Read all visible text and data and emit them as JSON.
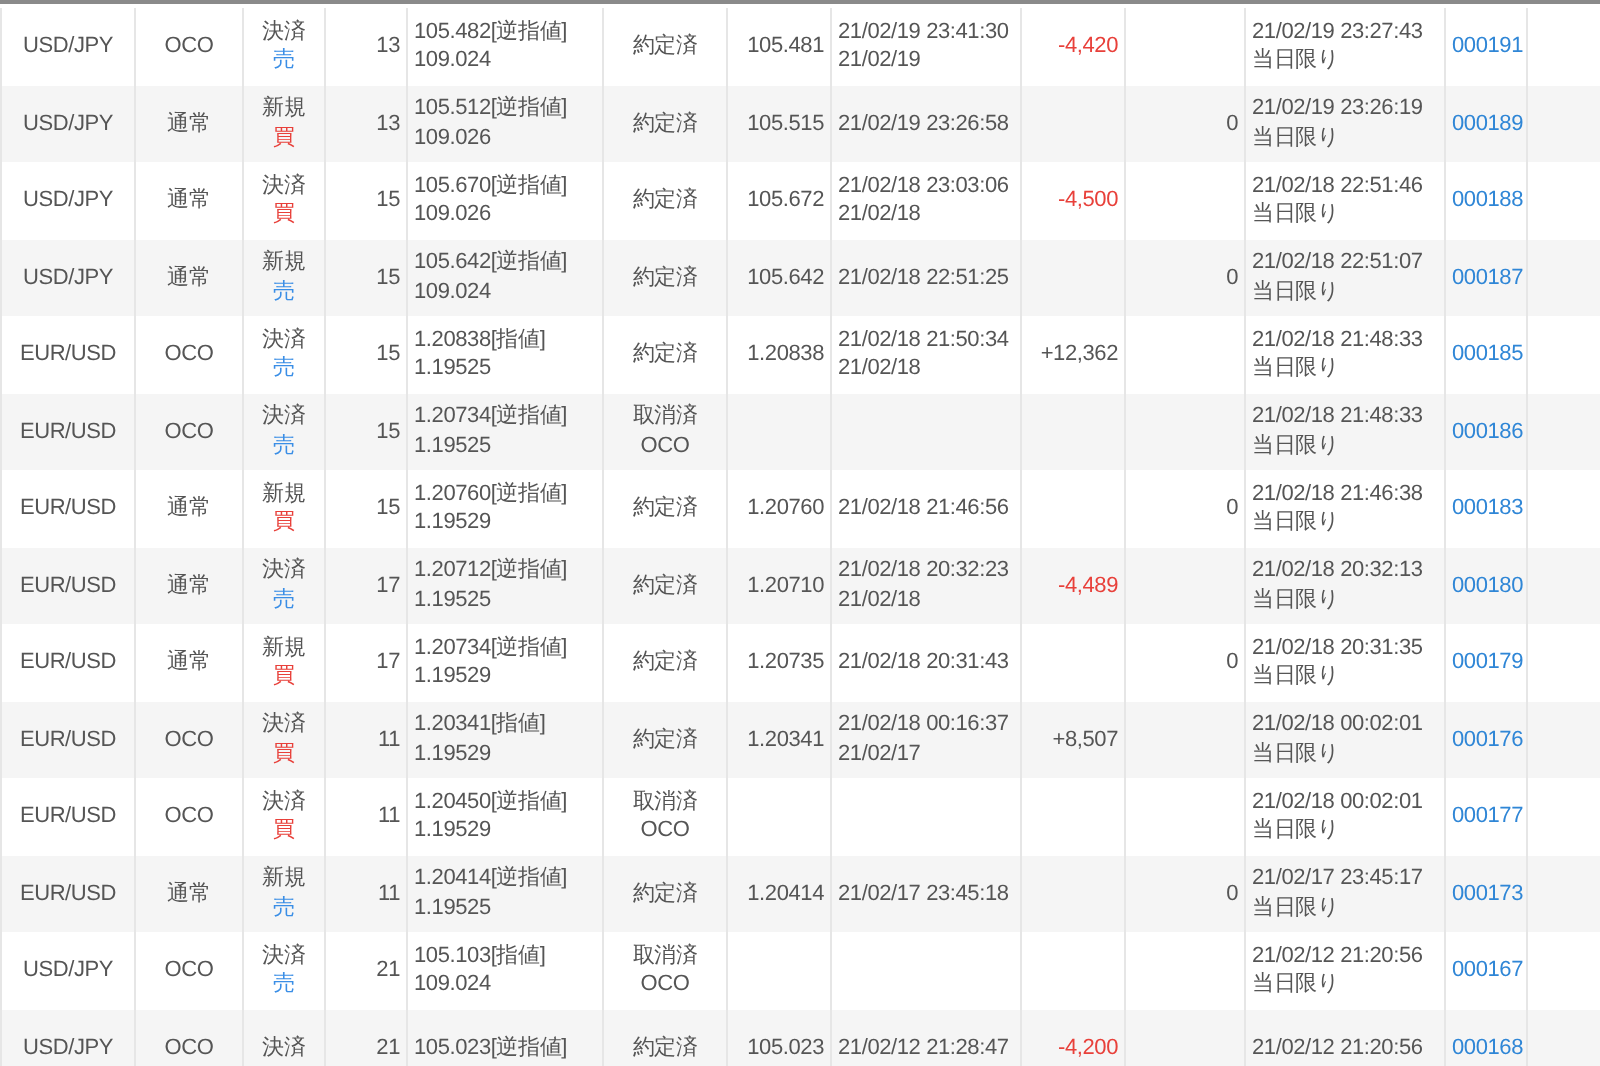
{
  "rows": [
    {
      "pair": "USD/JPY",
      "type": "OCO",
      "side": {
        "action": "決済",
        "direction": "売",
        "kind": "sell"
      },
      "quantity": "13",
      "price": [
        "105.482[逆指値]",
        "109.024"
      ],
      "status": [
        "約定済"
      ],
      "exec_price": "105.481",
      "exec_time": [
        "21/02/19 23:41:30",
        "21/02/19"
      ],
      "pnl": {
        "text": "-4,420",
        "kind": "loss"
      },
      "order_time": [
        "21/02/19 23:27:43",
        "当日限り"
      ],
      "order_no": "000191"
    },
    {
      "pair": "USD/JPY",
      "type": "通常",
      "side": {
        "action": "新規",
        "direction": "買",
        "kind": "buy"
      },
      "quantity": "13",
      "price": [
        "105.512[逆指値]",
        "109.026"
      ],
      "status": [
        "約定済"
      ],
      "exec_price": "105.515",
      "exec_time": [
        "21/02/19 23:26:58"
      ],
      "column_10": "0",
      "order_time": [
        "21/02/19 23:26:19",
        "当日限り"
      ],
      "order_no": "000189"
    },
    {
      "pair": "USD/JPY",
      "type": "通常",
      "side": {
        "action": "決済",
        "direction": "買",
        "kind": "buy"
      },
      "quantity": "15",
      "price": [
        "105.670[逆指値]",
        "109.026"
      ],
      "status": [
        "約定済"
      ],
      "exec_price": "105.672",
      "exec_time": [
        "21/02/18 23:03:06",
        "21/02/18"
      ],
      "pnl": {
        "text": "-4,500",
        "kind": "loss"
      },
      "order_time": [
        "21/02/18 22:51:46",
        "当日限り"
      ],
      "order_no": "000188"
    },
    {
      "pair": "USD/JPY",
      "type": "通常",
      "side": {
        "action": "新規",
        "direction": "売",
        "kind": "sell"
      },
      "quantity": "15",
      "price": [
        "105.642[逆指値]",
        "109.024"
      ],
      "status": [
        "約定済"
      ],
      "exec_price": "105.642",
      "exec_time": [
        "21/02/18 22:51:25"
      ],
      "column_10": "0",
      "order_time": [
        "21/02/18 22:51:07",
        "当日限り"
      ],
      "order_no": "000187"
    },
    {
      "pair": "EUR/USD",
      "type": "OCO",
      "side": {
        "action": "決済",
        "direction": "売",
        "kind": "sell"
      },
      "quantity": "15",
      "price": [
        "1.20838[指値]",
        "1.19525"
      ],
      "status": [
        "約定済"
      ],
      "exec_price": "1.20838",
      "exec_time": [
        "21/02/18 21:50:34",
        "21/02/18"
      ],
      "pnl": {
        "text": "+12,362",
        "kind": "gain"
      },
      "order_time": [
        "21/02/18 21:48:33",
        "当日限り"
      ],
      "order_no": "000185"
    },
    {
      "pair": "EUR/USD",
      "type": "OCO",
      "side": {
        "action": "決済",
        "direction": "売",
        "kind": "sell"
      },
      "quantity": "15",
      "price": [
        "1.20734[逆指値]",
        "1.19525"
      ],
      "status": [
        "取消済",
        "OCO"
      ],
      "order_time": [
        "21/02/18 21:48:33",
        "当日限り"
      ],
      "order_no": "000186"
    },
    {
      "pair": "EUR/USD",
      "type": "通常",
      "side": {
        "action": "新規",
        "direction": "買",
        "kind": "buy"
      },
      "quantity": "15",
      "price": [
        "1.20760[逆指値]",
        "1.19529"
      ],
      "status": [
        "約定済"
      ],
      "exec_price": "1.20760",
      "exec_time": [
        "21/02/18 21:46:56"
      ],
      "column_10": "0",
      "order_time": [
        "21/02/18 21:46:38",
        "当日限り"
      ],
      "order_no": "000183"
    },
    {
      "pair": "EUR/USD",
      "type": "通常",
      "side": {
        "action": "決済",
        "direction": "売",
        "kind": "sell"
      },
      "quantity": "17",
      "price": [
        "1.20712[逆指値]",
        "1.19525"
      ],
      "status": [
        "約定済"
      ],
      "exec_price": "1.20710",
      "exec_time": [
        "21/02/18 20:32:23",
        "21/02/18"
      ],
      "pnl": {
        "text": "-4,489",
        "kind": "loss"
      },
      "order_time": [
        "21/02/18 20:32:13",
        "当日限り"
      ],
      "order_no": "000180"
    },
    {
      "pair": "EUR/USD",
      "type": "通常",
      "side": {
        "action": "新規",
        "direction": "買",
        "kind": "buy"
      },
      "quantity": "17",
      "price": [
        "1.20734[逆指値]",
        "1.19529"
      ],
      "status": [
        "約定済"
      ],
      "exec_price": "1.20735",
      "exec_time": [
        "21/02/18 20:31:43"
      ],
      "column_10": "0",
      "order_time": [
        "21/02/18 20:31:35",
        "当日限り"
      ],
      "order_no": "000179"
    },
    {
      "pair": "EUR/USD",
      "type": "OCO",
      "side": {
        "action": "決済",
        "direction": "買",
        "kind": "buy"
      },
      "quantity": "11",
      "price": [
        "1.20341[指値]",
        "1.19529"
      ],
      "status": [
        "約定済"
      ],
      "exec_price": "1.20341",
      "exec_time": [
        "21/02/18 00:16:37",
        "21/02/17"
      ],
      "pnl": {
        "text": "+8,507",
        "kind": "gain"
      },
      "order_time": [
        "21/02/18 00:02:01",
        "当日限り"
      ],
      "order_no": "000176"
    },
    {
      "pair": "EUR/USD",
      "type": "OCO",
      "side": {
        "action": "決済",
        "direction": "買",
        "kind": "buy"
      },
      "quantity": "11",
      "price": [
        "1.20450[逆指値]",
        "1.19529"
      ],
      "status": [
        "取消済",
        "OCO"
      ],
      "order_time": [
        "21/02/18 00:02:01",
        "当日限り"
      ],
      "order_no": "000177"
    },
    {
      "pair": "EUR/USD",
      "type": "通常",
      "side": {
        "action": "新規",
        "direction": "売",
        "kind": "sell"
      },
      "quantity": "11",
      "price": [
        "1.20414[逆指値]",
        "1.19525"
      ],
      "status": [
        "約定済"
      ],
      "exec_price": "1.20414",
      "exec_time": [
        "21/02/17 23:45:18"
      ],
      "column_10": "0",
      "order_time": [
        "21/02/17 23:45:17",
        "当日限り"
      ],
      "order_no": "000173"
    },
    {
      "pair": "USD/JPY",
      "type": "OCO",
      "side": {
        "action": "決済",
        "direction": "売",
        "kind": "sell"
      },
      "quantity": "21",
      "price": [
        "105.103[指値]",
        "109.024"
      ],
      "status": [
        "取消済",
        "OCO"
      ],
      "order_time": [
        "21/02/12 21:20:56",
        "当日限り"
      ],
      "order_no": "000167"
    },
    {
      "pair": "USD/JPY",
      "type": "OCO",
      "side": {
        "action": "決済"
      },
      "quantity": "21",
      "price": [
        "105.023[逆指値]"
      ],
      "status": [
        "約定済"
      ],
      "exec_price": "105.023",
      "exec_time": [
        "21/02/12 21:28:47"
      ],
      "pnl": {
        "text": "-4,200",
        "kind": "loss"
      },
      "order_time": [
        "21/02/12 21:20:56"
      ],
      "order_no": "000168"
    }
  ]
}
